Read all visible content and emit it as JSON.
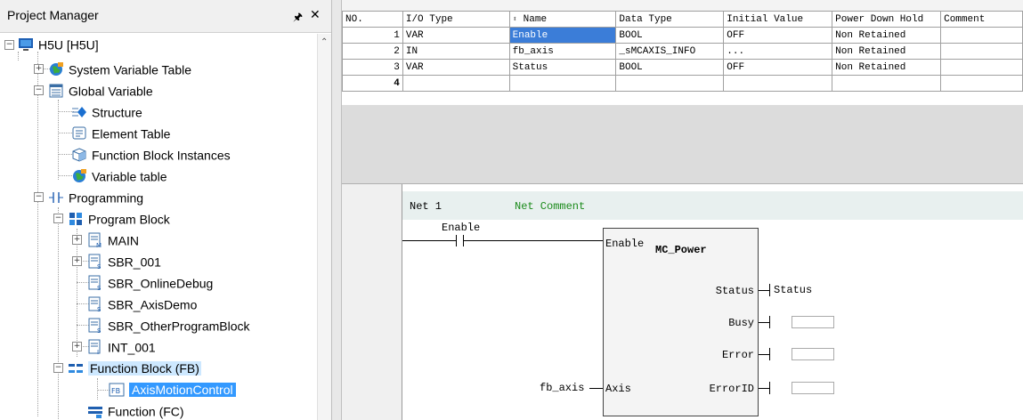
{
  "project_manager": {
    "title": "Project Manager",
    "pin_icon": "pin-icon",
    "close_icon": "close-icon",
    "tree": [
      {
        "label": "H5U [H5U]",
        "icon": "monitor-icon"
      },
      {
        "label": "System Variable Table",
        "icon": "globe-icon"
      },
      {
        "label": "Global Variable",
        "icon": "table-icon"
      },
      {
        "label": "Structure",
        "icon": "structure-icon"
      },
      {
        "label": "Element Table",
        "icon": "element-table-icon"
      },
      {
        "label": "Function Block Instances",
        "icon": "cube-icon"
      },
      {
        "label": "Variable table",
        "icon": "globe-icon"
      },
      {
        "label": "Programming",
        "icon": "ladder-icon"
      },
      {
        "label": "Program Block",
        "icon": "blocks-icon"
      },
      {
        "label": "MAIN",
        "icon": "program-m-icon"
      },
      {
        "label": "SBR_001",
        "icon": "program-s-icon"
      },
      {
        "label": "SBR_OnlineDebug",
        "icon": "program-s-icon"
      },
      {
        "label": "SBR_AxisDemo",
        "icon": "program-s-icon"
      },
      {
        "label": "SBR_OtherProgramBlock",
        "icon": "program-s-icon"
      },
      {
        "label": "INT_001",
        "icon": "program-i-icon"
      },
      {
        "label": "Function Block (FB)",
        "icon": "function-block-icon"
      },
      {
        "label": "AxisMotionControl",
        "icon": "fb-icon"
      },
      {
        "label": "Function (FC)",
        "icon": "function-icon"
      }
    ]
  },
  "variable_table": {
    "headers": [
      "NO.",
      "I/O Type",
      "Name",
      "Data Type",
      "Initial Value",
      "Power Down Hold",
      "Comment"
    ],
    "rows": [
      {
        "no": "1",
        "io": "VAR",
        "name": "Enable",
        "type": "BOOL",
        "init": "OFF",
        "hold": "Non Retained",
        "comment": ""
      },
      {
        "no": "2",
        "io": "IN",
        "name": "fb_axis",
        "type": "_sMCAXIS_INFO",
        "init": "...",
        "hold": "Non Retained",
        "comment": ""
      },
      {
        "no": "3",
        "io": "VAR",
        "name": "Status",
        "type": "BOOL",
        "init": "OFF",
        "hold": "Non Retained",
        "comment": ""
      },
      {
        "no": "4",
        "io": "",
        "name": "",
        "type": "",
        "init": "",
        "hold": "",
        "comment": ""
      }
    ]
  },
  "ladder": {
    "net_label": "Net 1",
    "net_comment": "Net Comment",
    "contact_label": "Enable",
    "block": {
      "input_enable": "Enable",
      "name": "MC_Power",
      "input_axis": "Axis",
      "axis_variable": "fb_axis",
      "outputs": [
        {
          "pin": "Status",
          "variable": "Status"
        },
        {
          "pin": "Busy",
          "variable": ""
        },
        {
          "pin": "Error",
          "variable": ""
        },
        {
          "pin": "ErrorID",
          "variable": ""
        }
      ]
    }
  },
  "colors": {
    "selection": "#3399ff",
    "cell_cursor": "#3b7dd8",
    "comment_green": "#1a8a1a",
    "net_bar": "#e8f0ef"
  }
}
